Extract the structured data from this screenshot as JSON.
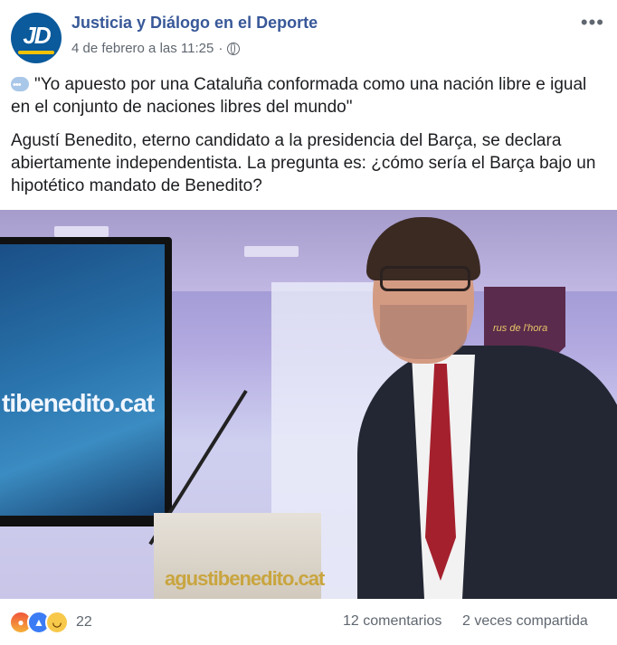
{
  "post": {
    "page_name": "Justicia y Diálogo en el Deporte",
    "avatar_text": "JD",
    "timestamp": "4 de febrero a las 11:25",
    "separator": "·",
    "more_label": "•••",
    "quote": "\"Yo apuesto por una Cataluña conformada como una nación libre e igual en el conjunto de naciones libres del mundo\"",
    "body": "Agustí Benedito, eterno candidato a la presidencia del Barça, se declara abiertamente independentista. La pregunta es: ¿cómo sería el Barça bajo un hipotético mandato de Benedito?",
    "photo": {
      "screen_text": "tibenedito.cat",
      "lectern_text": "agustibenedito.cat",
      "crest_text": "rus de l'hora"
    }
  },
  "footer": {
    "reaction_icons": [
      "angry-icon",
      "like-icon",
      "haha-icon"
    ],
    "reaction_count": "22",
    "comments": "12 comentarios",
    "shares": "2 veces compartida"
  },
  "colors": {
    "page_name": "#385898",
    "meta": "#606770",
    "text": "#1c1e21",
    "avatar_bg": "#0a5a9c",
    "avatar_accent": "#f2c200"
  }
}
